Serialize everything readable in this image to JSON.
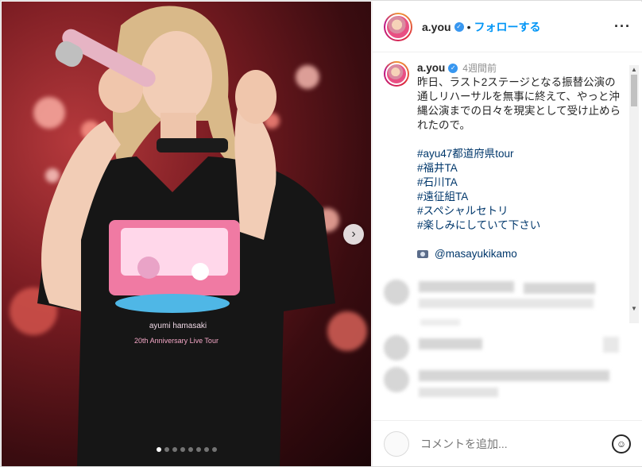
{
  "header": {
    "username": "a.you",
    "separator": "•",
    "follow_label": "フォローする",
    "more_icon": "more-horizontal-icon"
  },
  "post": {
    "username": "a.you",
    "time": "4週間前",
    "caption": "昨日、ラスト2ステージとなる振替公演の通しリハーサルを無事に終えて、やっと沖縄公演までの日々を現実として受け止められたので。",
    "hashtags": [
      "#ayu47都道府県tour",
      "#福井TA",
      "#石川TA",
      "#遠征組TA",
      "#スペシャルセトリ",
      "#楽しみにしていて下さい"
    ],
    "credit": "@masayukikamo"
  },
  "media": {
    "shirt_line1": "ayumi hamasaki",
    "shirt_line2": "20th Anniversary Live Tour",
    "carousel_count": 8,
    "carousel_active": 0
  },
  "comment": {
    "placeholder": "コメントを追加..."
  },
  "colors": {
    "accent": "#0095f6",
    "hashtag": "#00376b",
    "muted": "#8e8e8e"
  }
}
